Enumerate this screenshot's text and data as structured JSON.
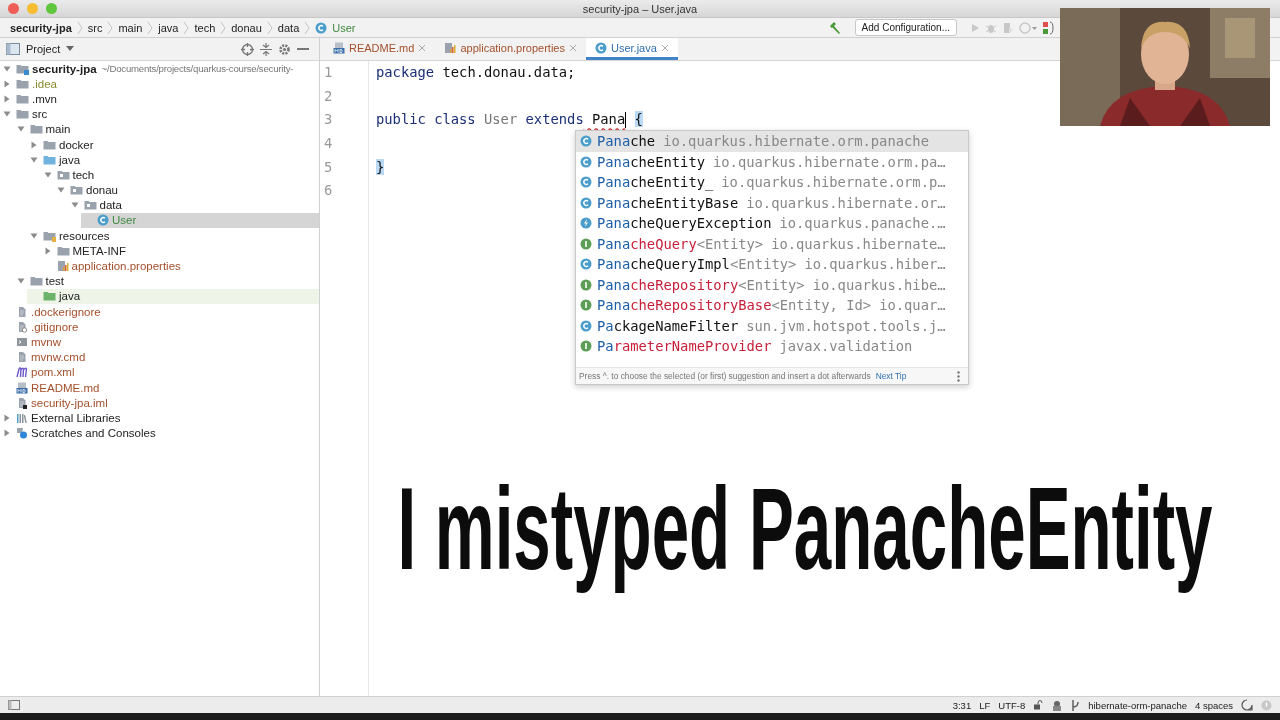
{
  "window": {
    "title": "security-jpa – User.java"
  },
  "breadcrumbs": [
    {
      "label": "security-jpa",
      "kind": "project"
    },
    {
      "label": "src",
      "kind": "folder"
    },
    {
      "label": "main",
      "kind": "folder"
    },
    {
      "label": "java",
      "kind": "folder"
    },
    {
      "label": "tech",
      "kind": "folder"
    },
    {
      "label": "donau",
      "kind": "folder"
    },
    {
      "label": "data",
      "kind": "folder"
    },
    {
      "label": "User",
      "kind": "class"
    }
  ],
  "toolbar": {
    "run_config_button": "Add Configuration..."
  },
  "project_panel": {
    "title": "Project",
    "tree": [
      {
        "label": "security-jpa",
        "hint": "~/Documents/projects/quarkus-course/security-",
        "kind": "module",
        "expanded": true,
        "selected": false,
        "children": [
          {
            "label": ".idea",
            "kind": "folder",
            "expanded": false,
            "selected": false,
            "color": "#8a8a2e"
          },
          {
            "label": ".mvn",
            "kind": "folder",
            "expanded": false,
            "selected": false
          },
          {
            "label": "src",
            "kind": "folder",
            "expanded": true,
            "selected": false,
            "children": [
              {
                "label": "main",
                "kind": "folder",
                "expanded": true,
                "selected": false,
                "children": [
                  {
                    "label": "docker",
                    "kind": "folder",
                    "expanded": false,
                    "selected": false
                  },
                  {
                    "label": "java",
                    "kind": "source-folder",
                    "expanded": true,
                    "selected": false,
                    "children": [
                      {
                        "label": "tech",
                        "kind": "package",
                        "expanded": true,
                        "selected": false,
                        "children": [
                          {
                            "label": "donau",
                            "kind": "package",
                            "expanded": true,
                            "selected": false,
                            "children": [
                              {
                                "label": "data",
                                "kind": "package",
                                "expanded": true,
                                "selected": false,
                                "children": [
                                  {
                                    "label": "User",
                                    "kind": "class",
                                    "selected": true,
                                    "color": "#3f8a3f"
                                  }
                                ]
                              }
                            ]
                          }
                        ]
                      }
                    ]
                  },
                  {
                    "label": "resources",
                    "kind": "resources-folder",
                    "expanded": true,
                    "selected": false,
                    "children": [
                      {
                        "label": "META-INF",
                        "kind": "folder",
                        "expanded": false,
                        "selected": false
                      },
                      {
                        "label": "application.properties",
                        "kind": "properties",
                        "selected": false,
                        "color": "#a4502c"
                      }
                    ]
                  }
                ]
              },
              {
                "label": "test",
                "kind": "folder",
                "expanded": true,
                "selected": false,
                "children": [
                  {
                    "label": "java",
                    "kind": "test-folder",
                    "selected": false
                  }
                ]
              }
            ]
          },
          {
            "label": ".dockerignore",
            "kind": "file",
            "selected": false,
            "color": "#a4502c"
          },
          {
            "label": ".gitignore",
            "kind": "ignore-file",
            "selected": false,
            "color": "#a4502c"
          },
          {
            "label": "mvnw",
            "kind": "script",
            "selected": false,
            "color": "#a4502c"
          },
          {
            "label": "mvnw.cmd",
            "kind": "file",
            "selected": false,
            "color": "#a4502c"
          },
          {
            "label": "pom.xml",
            "kind": "maven",
            "selected": false,
            "color": "#a4502c"
          },
          {
            "label": "README.md",
            "kind": "markdown",
            "selected": false,
            "color": "#a4502c"
          },
          {
            "label": "security-jpa.iml",
            "kind": "iml",
            "selected": false,
            "color": "#a4502c"
          }
        ]
      },
      {
        "label": "External Libraries",
        "kind": "libraries",
        "expanded": false,
        "selected": false
      },
      {
        "label": "Scratches and Consoles",
        "kind": "scratches",
        "expanded": false,
        "selected": false
      }
    ]
  },
  "editor_tabs": [
    {
      "label": "README.md",
      "kind": "markdown",
      "selected": false,
      "color": "#a4502c"
    },
    {
      "label": "application.properties",
      "kind": "properties",
      "selected": false,
      "color": "#a4502c"
    },
    {
      "label": "User.java",
      "kind": "class",
      "selected": true,
      "color": "#2f6fb0"
    }
  ],
  "code": [
    {
      "number": "1",
      "tokens": [
        {
          "text": "package",
          "kind": "keyword"
        },
        {
          "text": " tech.donau.data;",
          "kind": "plain"
        }
      ]
    },
    {
      "number": "2"
    },
    {
      "number": "3",
      "tokens": [
        {
          "text": "public class",
          "kind": "keyword"
        },
        {
          "text": " User",
          "kind": "unused"
        },
        {
          "text": " extends",
          "kind": "keyword"
        },
        {
          "text": " Pana",
          "kind": "typed"
        },
        {
          "text": "{",
          "kind": "brace-match",
          "space_before": true
        }
      ]
    },
    {
      "number": "4"
    },
    {
      "number": "5",
      "tokens": [
        {
          "text": "}",
          "kind": "brace-match"
        }
      ]
    },
    {
      "number": "6"
    }
  ],
  "completion": {
    "items": [
      {
        "match": "Pana",
        "rest": "che",
        "package": "io.quarkus.hibernate.orm.panache",
        "kind": "class",
        "selected": true
      },
      {
        "match": "Pana",
        "rest": "cheEntity",
        "package": "io.quarkus.hibernate.orm.pa…",
        "kind": "class",
        "selected": false
      },
      {
        "match": "Pana",
        "rest": "cheEntity_",
        "package": "io.quarkus.hibernate.orm.p…",
        "kind": "class",
        "selected": false
      },
      {
        "match": "Pana",
        "rest": "cheEntityBase",
        "package": "io.quarkus.hibernate.or…",
        "kind": "class",
        "selected": false
      },
      {
        "match": "Pana",
        "rest": "cheQueryException",
        "package": "io.quarkus.panache.…",
        "kind": "exception",
        "selected": false
      },
      {
        "match": "Pana",
        "rest": "cheQuery",
        "params": "<Entity>",
        "package": "io.quarkus.hibernate…",
        "kind": "interface",
        "selected": false
      },
      {
        "match": "Pana",
        "rest": "cheQueryImpl",
        "params": "<Entity>",
        "package": "io.quarkus.hiber…",
        "kind": "class",
        "selected": false
      },
      {
        "match": "Pana",
        "rest": "cheRepository",
        "params": "<Entity>",
        "package": "io.quarkus.hibe…",
        "kind": "interface",
        "selected": false
      },
      {
        "match": "Pana",
        "rest": "cheRepositoryBase",
        "params": "<Entity, Id>",
        "package": "io.quar…",
        "kind": "interface",
        "selected": false
      },
      {
        "match": "Pa",
        "rest": "ckageNameFilter",
        "package": "sun.jvm.hotspot.tools.j…",
        "kind": "class",
        "selected": false
      },
      {
        "match": "Pa",
        "rest": "rameterNameProvider",
        "package": "javax.validation",
        "kind": "interface",
        "selected": false
      }
    ],
    "hint": "Press ^. to choose the selected (or first) suggestion and insert a dot afterwards",
    "hint_link": "Next Tip"
  },
  "caption": "I mistyped PanacheEntity",
  "status_bar": {
    "position": "3:31",
    "line_separator": "LF",
    "encoding": "UTF-8",
    "branch": "hibernate-orm-panache",
    "indent": "4 spaces"
  }
}
